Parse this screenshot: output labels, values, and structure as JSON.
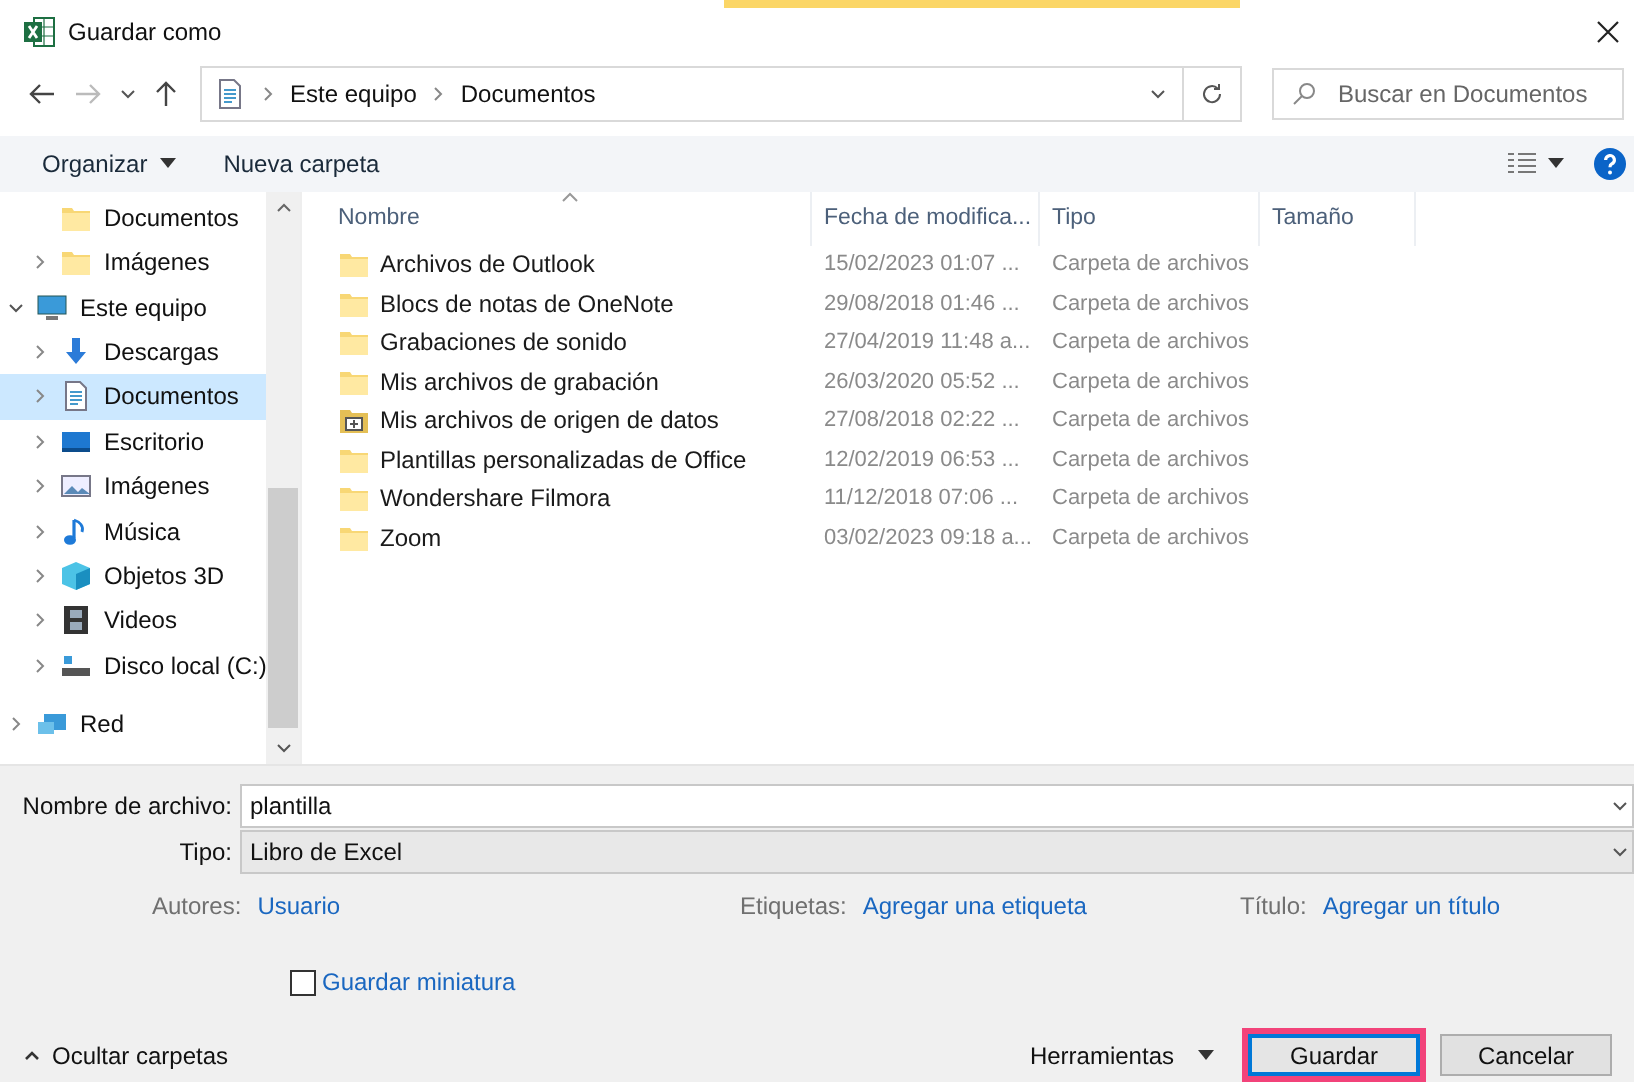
{
  "window": {
    "title": "Guardar como"
  },
  "address": {
    "path": [
      "Este equipo",
      "Documentos"
    ]
  },
  "search": {
    "placeholder": "Buscar en Documentos"
  },
  "toolbar": {
    "buttons": [
      {
        "label": "Organizar",
        "dropdown": true
      },
      {
        "label": "Nueva carpeta",
        "dropdown": false
      }
    ]
  },
  "sidebar": {
    "scrolled_children": [
      {
        "label": "Documentos",
        "kind": "folder",
        "expandable": false,
        "selected": false
      },
      {
        "label": "Imágenes",
        "kind": "folder",
        "expandable": true,
        "selected": false
      }
    ],
    "items": [
      {
        "label": "Este equipo",
        "kind": "pc",
        "expandable": true,
        "expanded": true,
        "selected": false,
        "children": [
          {
            "label": "Descargas",
            "kind": "download",
            "expandable": true,
            "selected": false
          },
          {
            "label": "Documentos",
            "kind": "doc",
            "expandable": true,
            "selected": true
          },
          {
            "label": "Escritorio",
            "kind": "desktop",
            "expandable": true,
            "selected": false
          },
          {
            "label": "Imágenes",
            "kind": "pictures",
            "expandable": true,
            "selected": false
          },
          {
            "label": "Música",
            "kind": "music",
            "expandable": true,
            "selected": false
          },
          {
            "label": "Objetos 3D",
            "kind": "cube",
            "expandable": true,
            "selected": false
          },
          {
            "label": "Videos",
            "kind": "film",
            "expandable": true,
            "selected": false
          },
          {
            "label": "Disco local (C:)",
            "kind": "drive",
            "expandable": true,
            "selected": false
          }
        ]
      },
      {
        "label": "Red",
        "kind": "network",
        "expandable": true,
        "expanded": false,
        "selected": false
      }
    ]
  },
  "table": {
    "columns": [
      "Nombre",
      "Fecha de modifica...",
      "Tipo",
      "Tamaño"
    ],
    "rows": [
      {
        "name": "Archivos de Outlook",
        "modified": "15/02/2023 01:07 ...",
        "type": "Carpeta de archivos",
        "kind": "folder"
      },
      {
        "name": "Blocs de notas de OneNote",
        "modified": "29/08/2018 01:46 ...",
        "type": "Carpeta de archivos",
        "kind": "folder"
      },
      {
        "name": "Grabaciones de sonido",
        "modified": "27/04/2019 11:48 a...",
        "type": "Carpeta de archivos",
        "kind": "folder"
      },
      {
        "name": "Mis archivos de grabación",
        "modified": "26/03/2020 05:52 ...",
        "type": "Carpeta de archivos",
        "kind": "folder"
      },
      {
        "name": "Mis archivos de origen de datos",
        "modified": "27/08/2018 02:22 ...",
        "type": "Carpeta de archivos",
        "kind": "datafolder"
      },
      {
        "name": "Plantillas personalizadas de Office",
        "modified": "12/02/2019 06:53 ...",
        "type": "Carpeta de archivos",
        "kind": "folder"
      },
      {
        "name": "Wondershare Filmora",
        "modified": "11/12/2018 07:06 ...",
        "type": "Carpeta de archivos",
        "kind": "folder"
      },
      {
        "name": "Zoom",
        "modified": "03/02/2023 09:18 a...",
        "type": "Carpeta de archivos",
        "kind": "folder"
      }
    ]
  },
  "form": {
    "filename_label": "Nombre de archivo:",
    "filename": "plantilla",
    "type_label": "Tipo:",
    "type": "Libro de Excel",
    "meta": [
      {
        "label": "Autores:",
        "value": "Usuario"
      },
      {
        "label": "Etiquetas:",
        "value": "Agregar una etiqueta"
      },
      {
        "label": "Título:",
        "value": "Agregar un título"
      }
    ],
    "thumbnail": {
      "label": "Guardar miniatura",
      "checked": false
    }
  },
  "footer": {
    "toggle": "Ocultar carpetas",
    "tools": "Herramientas",
    "buttons": [
      {
        "label": "Guardar",
        "default": true,
        "highlighted": true
      },
      {
        "label": "Cancelar",
        "default": false,
        "highlighted": false
      }
    ]
  }
}
